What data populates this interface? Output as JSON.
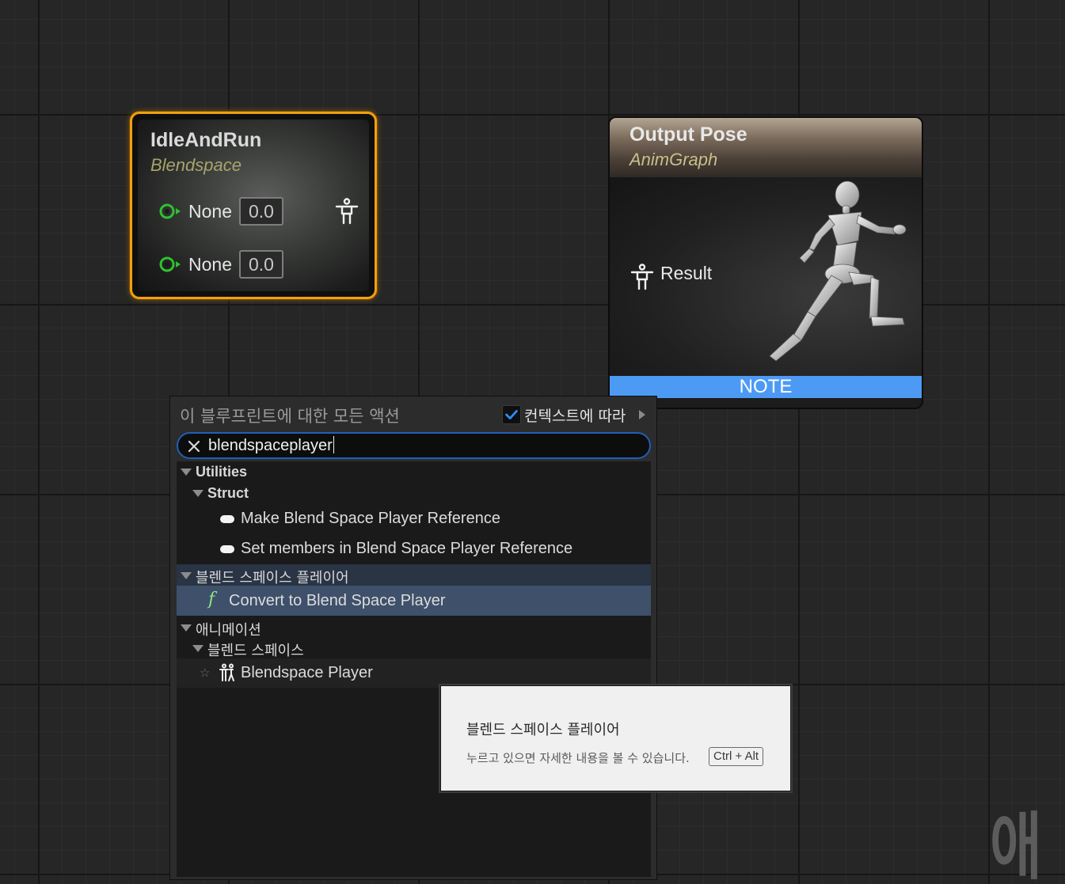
{
  "blendspace_node": {
    "title": "IdleAndRun",
    "subtitle": "Blendspace",
    "pins": [
      {
        "label": "None",
        "value": "0.0"
      },
      {
        "label": "None",
        "value": "0.0"
      }
    ],
    "colors": {
      "border": "#f0a010",
      "pin": "#2ec22e",
      "subtitle": "#a8a46a"
    }
  },
  "output_pose_node": {
    "title": "Output Pose",
    "subtitle": "AnimGraph",
    "result_label": "Result",
    "note_label": "NOTE",
    "colors": {
      "note_bar": "#4d9af5"
    }
  },
  "action_menu": {
    "title": "이 블루프린트에 대한 모든 액션",
    "context_label": "컨텍스트에 따라",
    "context_checked": true,
    "search": {
      "value": "blendspaceplayer"
    },
    "tree": {
      "utilities": {
        "label": "Utilities",
        "struct": {
          "label": "Struct",
          "items": [
            "Make Blend Space Player Reference",
            "Set members in Blend Space Player Reference"
          ]
        }
      },
      "blend_space_player_category": {
        "label": "블렌드 스페이스 플레이어",
        "items": [
          "Convert to Blend Space Player"
        ]
      },
      "animation": {
        "label": "애니메이션",
        "blend_space": {
          "label": "블렌드 스페이스",
          "items": [
            "Blendspace Player"
          ]
        }
      }
    }
  },
  "tooltip": {
    "title": "블렌드 스페이스 플레이어",
    "hint": "누르고 있으면 자세한 내용을 볼 수 있습니다.",
    "shortcut": "Ctrl + Alt"
  },
  "watermark": {
    "text": "애"
  }
}
